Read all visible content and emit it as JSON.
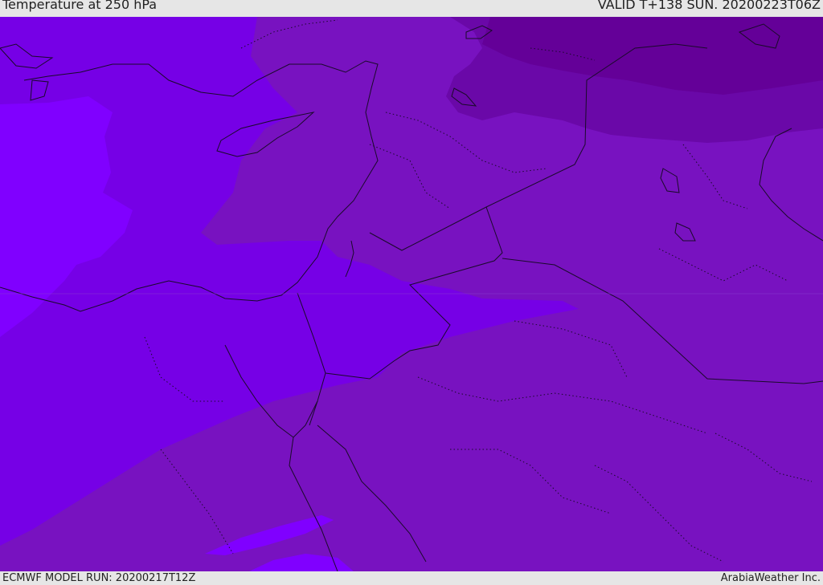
{
  "header": {
    "title": "Temperature at 250 hPa",
    "valid": "VALID T+138 SUN. 20200223T06Z"
  },
  "footer": {
    "model_run": "ECMWF MODEL RUN: 20200217T12Z",
    "credit": "ArabiaWeather Inc."
  },
  "colors": {
    "warmest": "#8000ff",
    "warm": "#7600e6",
    "mid": "#7812c0",
    "cold": "#6a08a8",
    "coldest": "#640098",
    "border": "#1a0a2a"
  }
}
